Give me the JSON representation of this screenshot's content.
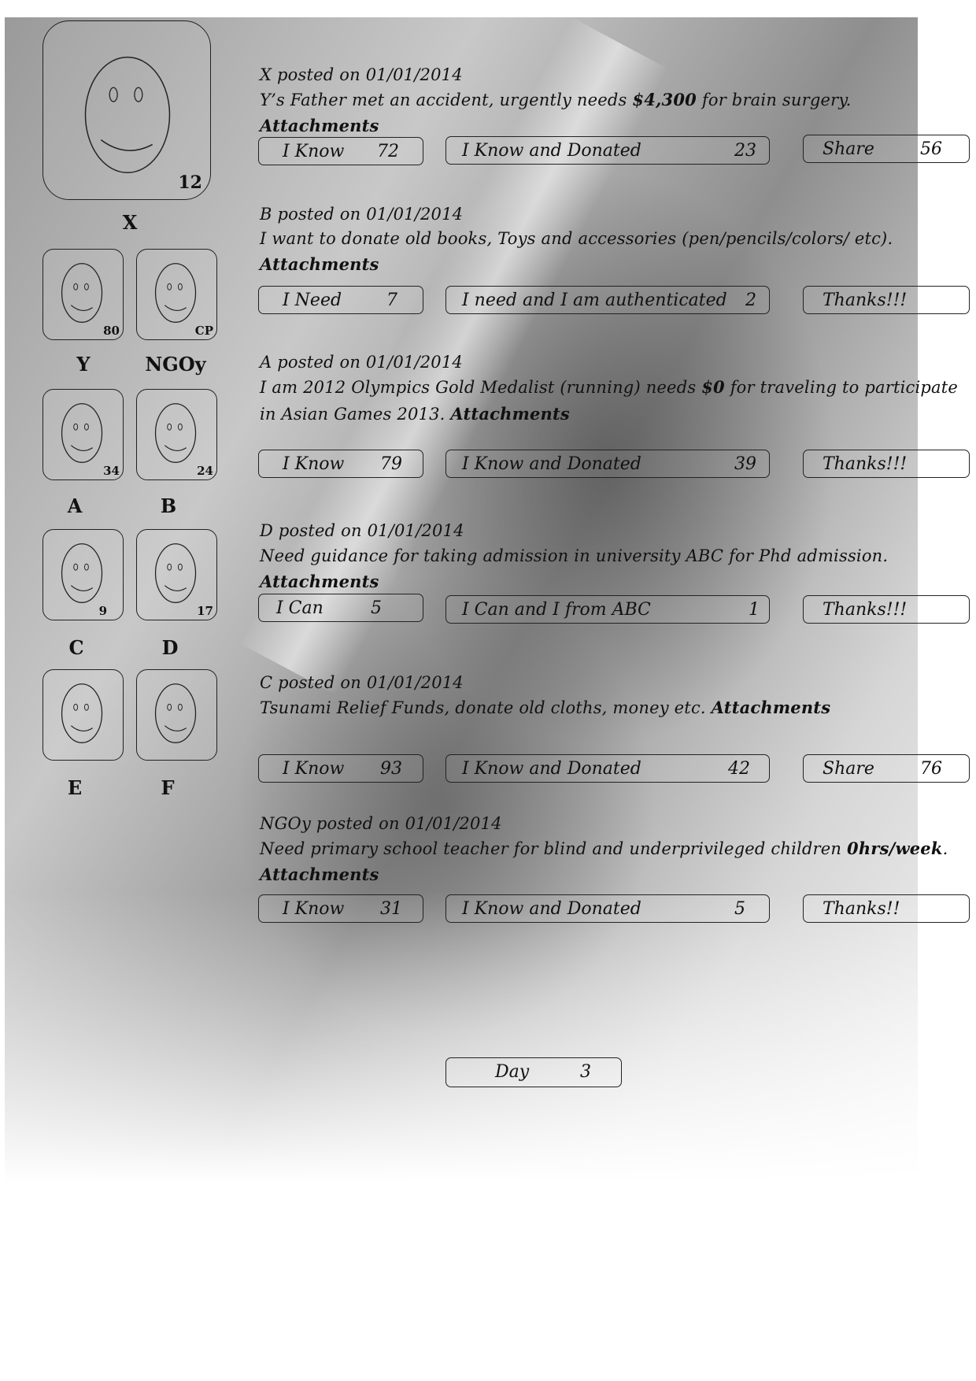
{
  "avatars": [
    {
      "name": "X",
      "count": "12"
    },
    {
      "name": "Y",
      "count": "80"
    },
    {
      "name": "NGOy",
      "count": "CP"
    },
    {
      "name": "A",
      "count": "34"
    },
    {
      "name": "B",
      "count": "24"
    },
    {
      "name": "C",
      "count": "9"
    },
    {
      "name": "D",
      "count": "17"
    },
    {
      "name": "E",
      "count": ""
    },
    {
      "name": "F",
      "count": ""
    }
  ],
  "posts": [
    {
      "header": "X posted on 01/01/2014",
      "text_pre": "Y’s Father met an accident, urgently needs ",
      "text_bold": "$4,300",
      "text_post": " for brain surgery.",
      "attachments": "Attachments",
      "buttons": [
        {
          "label": "I Know",
          "count": "72"
        },
        {
          "label": "I Know and Donated",
          "count": "23"
        },
        {
          "label": "Share",
          "count": "56"
        }
      ]
    },
    {
      "header": "B posted on 01/01/2014",
      "text": "I want to donate old books, Toys and accessories (pen/pencils/colors/ etc).",
      "attachments": "Attachments",
      "buttons": [
        {
          "label": "I Need",
          "count": "7"
        },
        {
          "label": "I need and I am authenticated",
          "count": "2"
        },
        {
          "label": "Thanks!!!",
          "count": ""
        }
      ]
    },
    {
      "header": "A posted on 01/01/2014",
      "text_pre": "I am 2012 Olympics Gold Medalist (running) needs ",
      "text_bold": "$0",
      "text_post": " for traveling to participate in Asian Games 2013. ",
      "attachments": "Attachments",
      "buttons": [
        {
          "label": "I Know",
          "count": "79"
        },
        {
          "label": "I Know and Donated",
          "count": "39"
        },
        {
          "label": "Thanks!!!",
          "count": ""
        }
      ]
    },
    {
      "header": "D posted on 01/01/2014",
      "text": "Need guidance for taking admission in university ABC for Phd  admission.",
      "attachments": "Attachments",
      "buttons": [
        {
          "label": "I Can",
          "count": "5"
        },
        {
          "label": "I Can and I from ABC",
          "count": "1"
        },
        {
          "label": "Thanks!!!",
          "count": ""
        }
      ]
    },
    {
      "header": "C posted on 01/01/2014",
      "text": "Tsunami Relief Funds, donate old cloths, money etc. ",
      "attachments": "Attachments",
      "buttons": [
        {
          "label": "I Know",
          "count": "93"
        },
        {
          "label": "I Know and Donated",
          "count": "42"
        },
        {
          "label": "Share",
          "count": "76"
        }
      ]
    },
    {
      "header": "NGOy posted on 01/01/2014",
      "text_pre": "Need primary school teacher for blind and underprivileged children ",
      "text_bold": "0hrs/week",
      "text_post": ".",
      "attachments": "Attachments",
      "buttons": [
        {
          "label": "I Know",
          "count": "31"
        },
        {
          "label": "I Know and Donated",
          "count": "5"
        },
        {
          "label": "Thanks!!",
          "count": ""
        }
      ]
    }
  ],
  "day": {
    "label": "Day",
    "value": "3"
  },
  "icons": {
    "avatar": "smiley-face-icon"
  }
}
